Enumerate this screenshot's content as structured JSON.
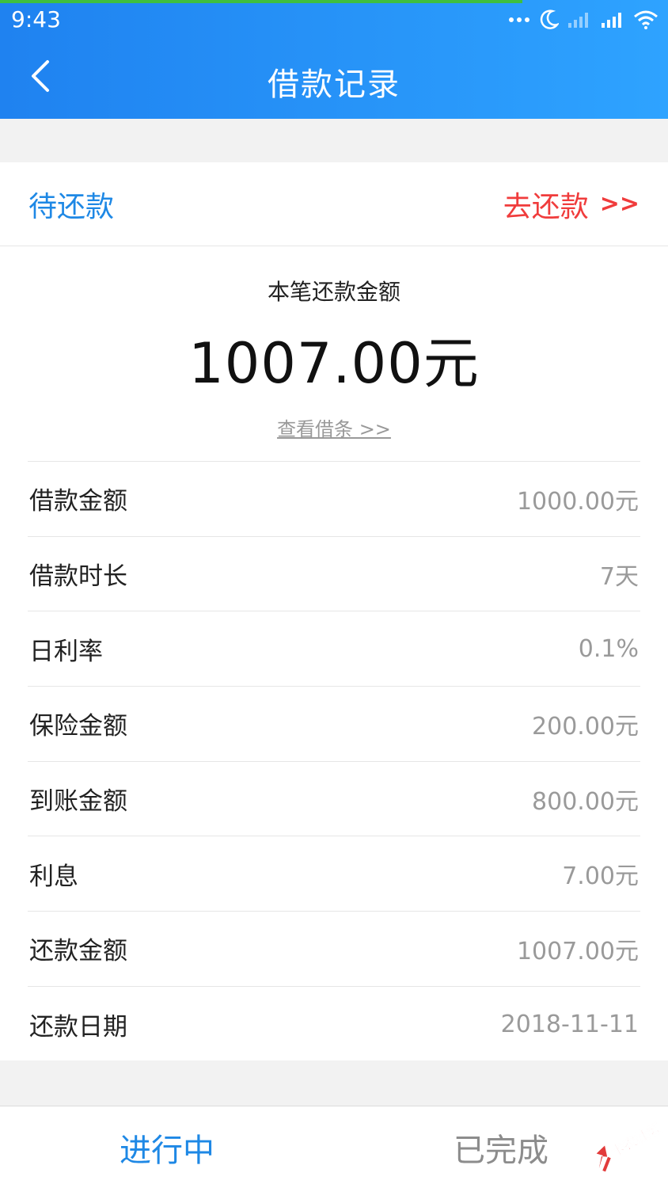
{
  "status_bar": {
    "time": "9:43",
    "icons": [
      "more-dots-icon",
      "moon-icon",
      "signal-weak-icon",
      "signal-icon",
      "wifi-icon"
    ]
  },
  "header": {
    "title": "借款记录"
  },
  "card": {
    "status_label": "待还款",
    "action_label": "去还款",
    "action_arrows": ">>"
  },
  "summary": {
    "label": "本笔还款金额",
    "amount": "1007.00元",
    "link": "查看借条 >>"
  },
  "details": [
    {
      "label": "借款金额",
      "value": "1000.00元"
    },
    {
      "label": "借款时长",
      "value": "7天"
    },
    {
      "label": "日利率",
      "value": "0.1%"
    },
    {
      "label": "保险金额",
      "value": "200.00元"
    },
    {
      "label": "到账金额",
      "value": "800.00元"
    },
    {
      "label": "利息",
      "value": "7.00元"
    },
    {
      "label": "还款金额",
      "value": "1007.00元"
    },
    {
      "label": "还款日期",
      "value": "2018-11-11"
    }
  ],
  "tabs": [
    {
      "label": "进行中",
      "active": true
    },
    {
      "label": "已完成",
      "active": false
    }
  ],
  "watermark": {
    "text": "卡农社区"
  },
  "colors": {
    "header_start": "#1f82f0",
    "header_end": "#2ea3ff",
    "accent_blue": "#1e88e5",
    "accent_red": "#f03c3c",
    "muted_gray": "#9a9a9a"
  }
}
